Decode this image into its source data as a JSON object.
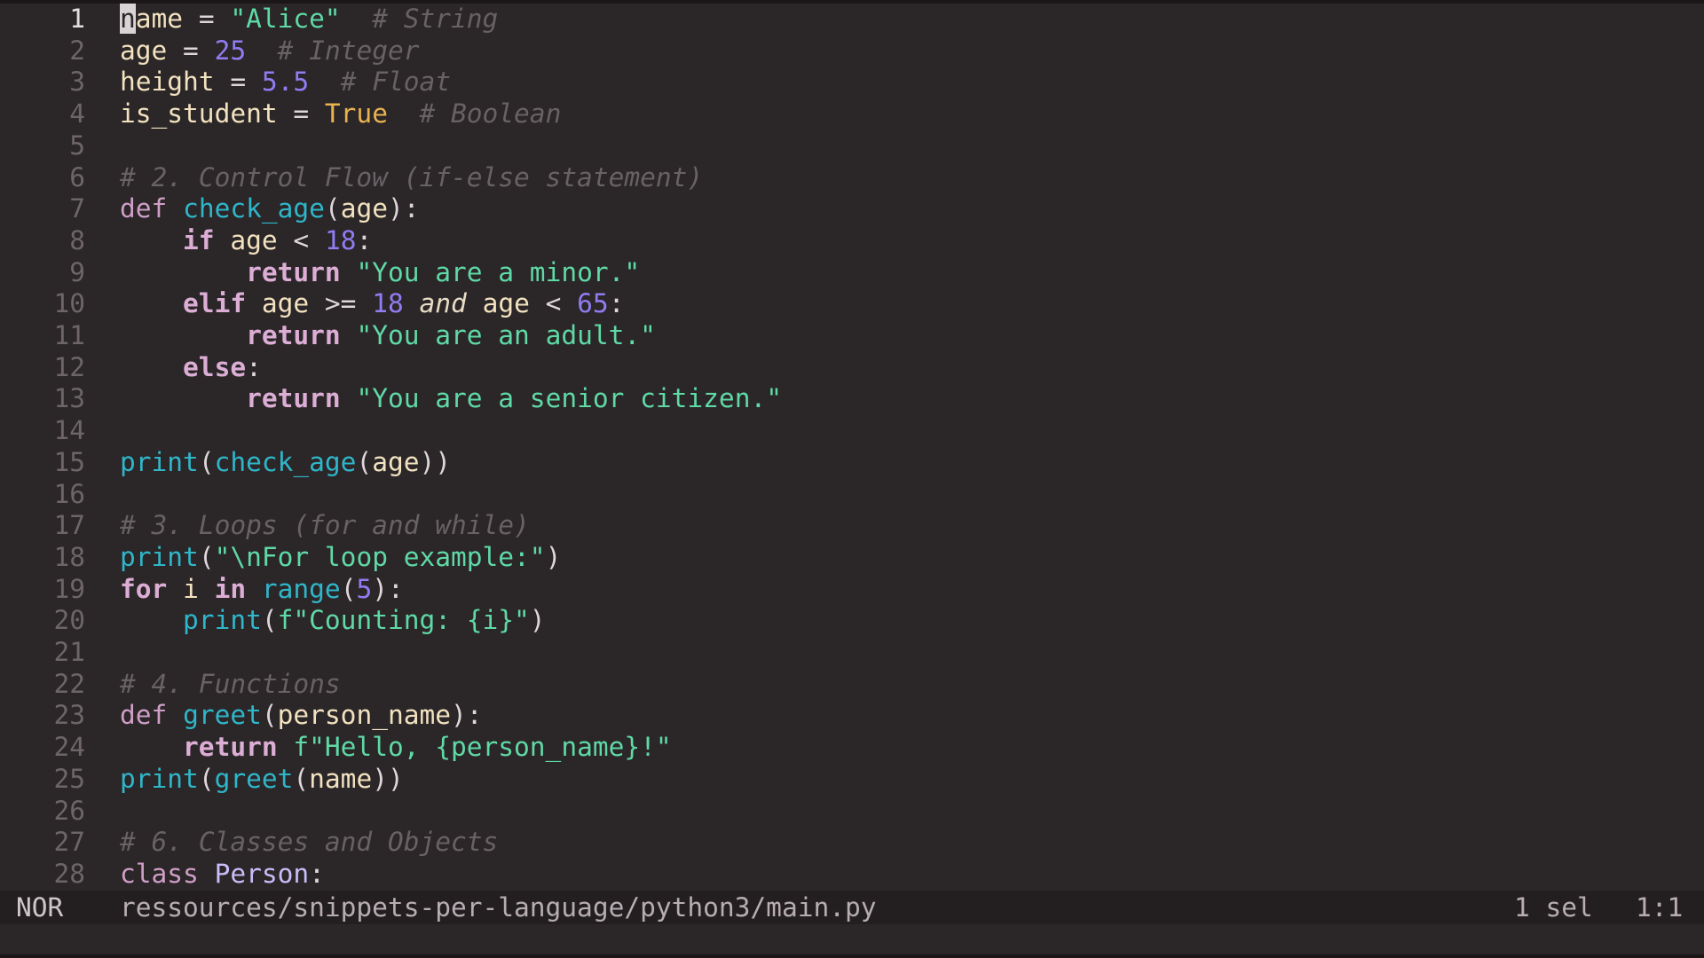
{
  "editor": {
    "lines": [
      {
        "n": "1",
        "tokens": [
          [
            "cursor",
            "n"
          ],
          [
            "var",
            "ame"
          ],
          [
            "op",
            " = "
          ],
          [
            "str",
            "\"Alice\""
          ],
          [
            "op",
            "  "
          ],
          [
            "cmt",
            "# String"
          ]
        ]
      },
      {
        "n": "2",
        "tokens": [
          [
            "var",
            "age"
          ],
          [
            "op",
            " = "
          ],
          [
            "num",
            "25"
          ],
          [
            "op",
            "  "
          ],
          [
            "cmt",
            "# Integer"
          ]
        ]
      },
      {
        "n": "3",
        "tokens": [
          [
            "var",
            "height"
          ],
          [
            "op",
            " = "
          ],
          [
            "num",
            "5.5"
          ],
          [
            "op",
            "  "
          ],
          [
            "cmt",
            "# Float"
          ]
        ]
      },
      {
        "n": "4",
        "tokens": [
          [
            "var",
            "is_student"
          ],
          [
            "op",
            " = "
          ],
          [
            "bool",
            "True"
          ],
          [
            "op",
            "  "
          ],
          [
            "cmt",
            "# Boolean"
          ]
        ]
      },
      {
        "n": "5",
        "tokens": []
      },
      {
        "n": "6",
        "tokens": [
          [
            "cmt",
            "# 2. Control Flow (if-else statement)"
          ]
        ]
      },
      {
        "n": "7",
        "tokens": [
          [
            "kw",
            "def"
          ],
          [
            "op",
            " "
          ],
          [
            "fn",
            "check_age"
          ],
          [
            "op",
            "("
          ],
          [
            "var",
            "age"
          ],
          [
            "op",
            "):"
          ]
        ]
      },
      {
        "n": "8",
        "tokens": [
          [
            "op",
            "    "
          ],
          [
            "kwb",
            "if"
          ],
          [
            "op",
            " "
          ],
          [
            "var",
            "age"
          ],
          [
            "op",
            " < "
          ],
          [
            "num",
            "18"
          ],
          [
            "op",
            ":"
          ]
        ]
      },
      {
        "n": "9",
        "tokens": [
          [
            "op",
            "        "
          ],
          [
            "kwb",
            "return"
          ],
          [
            "op",
            " "
          ],
          [
            "str",
            "\"You are a minor.\""
          ]
        ]
      },
      {
        "n": "10",
        "tokens": [
          [
            "op",
            "    "
          ],
          [
            "kwb",
            "elif"
          ],
          [
            "op",
            " "
          ],
          [
            "var",
            "age"
          ],
          [
            "op",
            " >= "
          ],
          [
            "num",
            "18"
          ],
          [
            "op",
            " "
          ],
          [
            "it",
            "and"
          ],
          [
            "op",
            " "
          ],
          [
            "var",
            "age"
          ],
          [
            "op",
            " < "
          ],
          [
            "num",
            "65"
          ],
          [
            "op",
            ":"
          ]
        ]
      },
      {
        "n": "11",
        "tokens": [
          [
            "op",
            "        "
          ],
          [
            "kwb",
            "return"
          ],
          [
            "op",
            " "
          ],
          [
            "str",
            "\"You are an adult.\""
          ]
        ]
      },
      {
        "n": "12",
        "tokens": [
          [
            "op",
            "    "
          ],
          [
            "kwb",
            "else"
          ],
          [
            "op",
            ":"
          ]
        ]
      },
      {
        "n": "13",
        "tokens": [
          [
            "op",
            "        "
          ],
          [
            "kwb",
            "return"
          ],
          [
            "op",
            " "
          ],
          [
            "str",
            "\"You are a senior citizen.\""
          ]
        ]
      },
      {
        "n": "14",
        "tokens": []
      },
      {
        "n": "15",
        "tokens": [
          [
            "fn",
            "print"
          ],
          [
            "op",
            "("
          ],
          [
            "fn",
            "check_age"
          ],
          [
            "op",
            "("
          ],
          [
            "var",
            "age"
          ],
          [
            "op",
            "))"
          ]
        ]
      },
      {
        "n": "16",
        "tokens": []
      },
      {
        "n": "17",
        "tokens": [
          [
            "cmt",
            "# 3. Loops (for and while)"
          ]
        ]
      },
      {
        "n": "18",
        "tokens": [
          [
            "fn",
            "print"
          ],
          [
            "op",
            "("
          ],
          [
            "str",
            "\""
          ],
          [
            "esc",
            "\\n"
          ],
          [
            "str",
            "For loop example:\""
          ],
          [
            "op",
            ")"
          ]
        ]
      },
      {
        "n": "19",
        "tokens": [
          [
            "kwb",
            "for"
          ],
          [
            "op",
            " "
          ],
          [
            "var",
            "i"
          ],
          [
            "op",
            " "
          ],
          [
            "kwb",
            "in"
          ],
          [
            "op",
            " "
          ],
          [
            "fn",
            "range"
          ],
          [
            "op",
            "("
          ],
          [
            "num",
            "5"
          ],
          [
            "op",
            "):"
          ]
        ]
      },
      {
        "n": "20",
        "tokens": [
          [
            "op",
            "    "
          ],
          [
            "fn",
            "print"
          ],
          [
            "op",
            "("
          ],
          [
            "str",
            "f\"Counting: {i}\""
          ],
          [
            "op",
            ")"
          ]
        ]
      },
      {
        "n": "21",
        "tokens": []
      },
      {
        "n": "22",
        "tokens": [
          [
            "cmt",
            "# 4. Functions"
          ]
        ]
      },
      {
        "n": "23",
        "tokens": [
          [
            "kw",
            "def"
          ],
          [
            "op",
            " "
          ],
          [
            "fn",
            "greet"
          ],
          [
            "op",
            "("
          ],
          [
            "var",
            "person_name"
          ],
          [
            "op",
            "):"
          ]
        ]
      },
      {
        "n": "24",
        "tokens": [
          [
            "op",
            "    "
          ],
          [
            "kwb",
            "return"
          ],
          [
            "op",
            " "
          ],
          [
            "str",
            "f\"Hello, {person_name}!\""
          ]
        ]
      },
      {
        "n": "25",
        "tokens": [
          [
            "fn",
            "print"
          ],
          [
            "op",
            "("
          ],
          [
            "fn",
            "greet"
          ],
          [
            "op",
            "("
          ],
          [
            "var",
            "name"
          ],
          [
            "op",
            "))"
          ]
        ]
      },
      {
        "n": "26",
        "tokens": []
      },
      {
        "n": "27",
        "tokens": [
          [
            "cmt",
            "# 6. Classes and Objects"
          ]
        ]
      },
      {
        "n": "28",
        "tokens": [
          [
            "kw",
            "class"
          ],
          [
            "op",
            " "
          ],
          [
            "cls",
            "Person"
          ],
          [
            "op",
            ":"
          ]
        ]
      }
    ]
  },
  "statusbar": {
    "mode": "NOR",
    "file_path": "ressources/snippets-per-language/python3/main.py",
    "selection_count": "1 sel",
    "cursor_position": "1:1"
  },
  "theme": {
    "background": "#2b2628",
    "string": "#5fd9a6",
    "number": "#8f7df1",
    "boolean": "#e9b34f",
    "comment": "#686165",
    "keyword": "#cf9fc7",
    "function": "#2fb6c9"
  }
}
